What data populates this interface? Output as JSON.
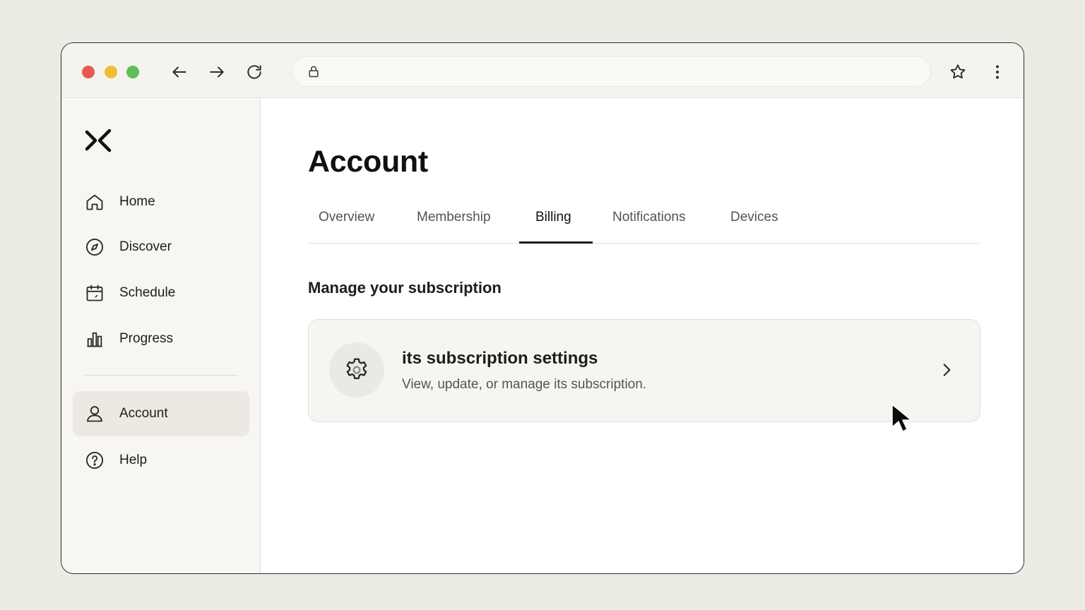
{
  "browser": {
    "url": "",
    "traffic_lights": {
      "close": "#e8594f",
      "minimize": "#f0bd3a",
      "maximize": "#5fbf5a"
    }
  },
  "sidebar": {
    "logo_icon": "x-chevron-logo",
    "items": [
      {
        "label": "Home",
        "icon": "home-icon",
        "active": false
      },
      {
        "label": "Discover",
        "icon": "compass-icon",
        "active": false
      },
      {
        "label": "Schedule",
        "icon": "calendar-icon",
        "active": false
      },
      {
        "label": "Progress",
        "icon": "bar-chart-icon",
        "active": false
      },
      {
        "label": "Account",
        "icon": "user-icon",
        "active": true
      },
      {
        "label": "Help",
        "icon": "help-icon",
        "active": false
      }
    ]
  },
  "main": {
    "title": "Account",
    "tabs": [
      {
        "label": "Overview",
        "active": false
      },
      {
        "label": "Membership",
        "active": false
      },
      {
        "label": "Billing",
        "active": true
      },
      {
        "label": "Notifications",
        "active": false
      },
      {
        "label": "Devices",
        "active": false
      }
    ],
    "section_title": "Manage your subscription",
    "card": {
      "icon": "gear-icon",
      "title": "its subscription settings",
      "description": "View, update, or manage its subscription."
    }
  },
  "colors": {
    "background": "#ecebe4",
    "sidebar_bg": "#f7f6f2",
    "active_item_bg": "#ebe9e2",
    "card_bg": "#f6f5f1",
    "text": "#1d1d1b"
  }
}
